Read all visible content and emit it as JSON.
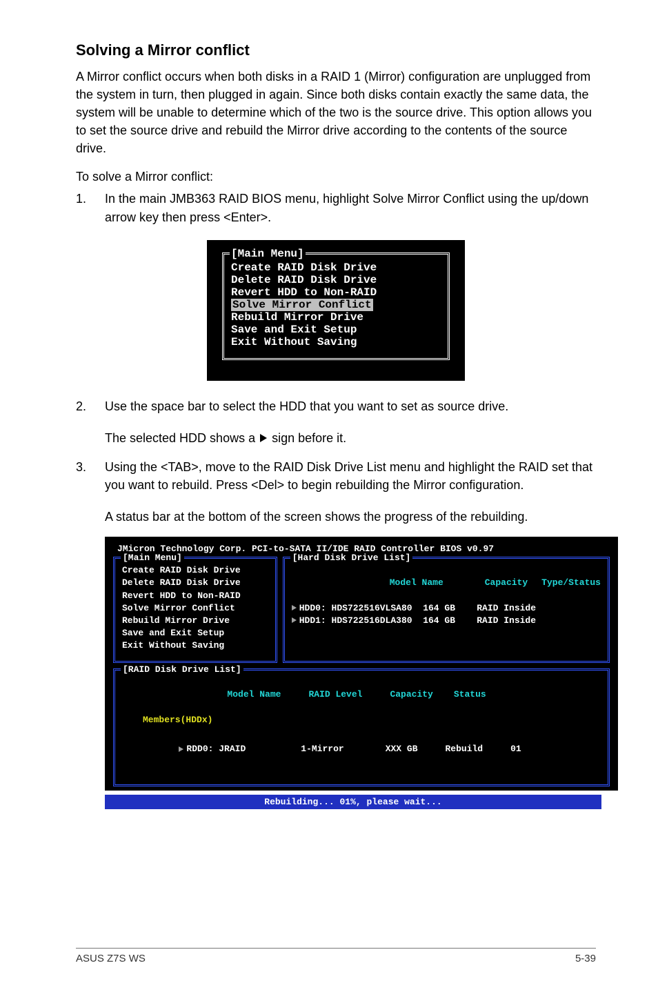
{
  "section_title": "Solving a Mirror conflict",
  "intro": "A Mirror conflict occurs when both disks in a RAID 1 (Mirror) configuration are unplugged from the system in turn, then plugged in again. Since both disks contain exactly the same data, the system will be unable to determine which of the two is the source drive. This option allows you to set the source drive and rebuild the Mirror drive according to the contents of the source drive.",
  "solve_lead": "To solve a Mirror conflict:",
  "step1_num": "1.",
  "step1": "In the main JMB363 RAID BIOS menu, highlight Solve Mirror Conflict using the up/down arrow key then press <Enter>.",
  "step2_num": "2.",
  "step2": "Use the space bar to select the HDD that you want to set as source drive.",
  "step2_after_a": "The selected HDD shows a ",
  "step2_after_b": " sign before it.",
  "step3_num": "3.",
  "step3": "Using the <TAB>, move to the RAID Disk Drive List menu and highlight the RAID set that you want to rebuild. Press <Del> to begin rebuilding the Mirror configuration.",
  "step3_after": "A status bar at the bottom of the screen shows the progress of the rebuilding.",
  "small_menu": {
    "title": "[Main Menu]",
    "items": [
      "Create RAID Disk Drive",
      "Delete RAID Disk Drive",
      "Revert HDD to Non-RAID",
      "Solve Mirror Conflict",
      "Rebuild Mirror Drive",
      "Save and Exit Setup",
      "Exit Without Saving"
    ],
    "selected_index": 3
  },
  "large": {
    "header": "JMicron Technology Corp. PCI-to-SATA II/IDE RAID Controller BIOS v0.97",
    "main_title": "[Main Menu]",
    "main_items": [
      "Create RAID Disk Drive",
      "Delete RAID Disk Drive",
      "Revert HDD to Non-RAID",
      "Solve Mirror Conflict",
      "Rebuild Mirror Drive",
      "Save and Exit Setup",
      "Exit Without Saving"
    ],
    "hdd_title": "[Hard Disk Drive List]",
    "hdd_headers": {
      "model": "Model Name",
      "capacity": "Capacity",
      "type": "Type/Status"
    },
    "hdd_rows": [
      {
        "slot": "HDD0:",
        "model": "HDS722516VLSA80",
        "cap": "164 GB",
        "type": "RAID Inside"
      },
      {
        "slot": "HDD1:",
        "model": "HDS722516DLA380",
        "cap": "164 GB",
        "type": "RAID Inside"
      }
    ],
    "raid_title": "[RAID Disk Drive List]",
    "raid_headers": {
      "model": "Model Name",
      "level": "RAID Level",
      "capacity": "Capacity",
      "status": "Status"
    },
    "raid_members": "Members(HDDx)",
    "raid_row": {
      "slot": "RDD0:",
      "name": "JRAID",
      "level": "1-Mirror",
      "cap": "XXX GB",
      "status": "Rebuild",
      "members": "01"
    },
    "status_bar": "Rebuilding... 01%, please wait..."
  },
  "footer_left": "ASUS Z7S WS",
  "footer_right": "5-39"
}
